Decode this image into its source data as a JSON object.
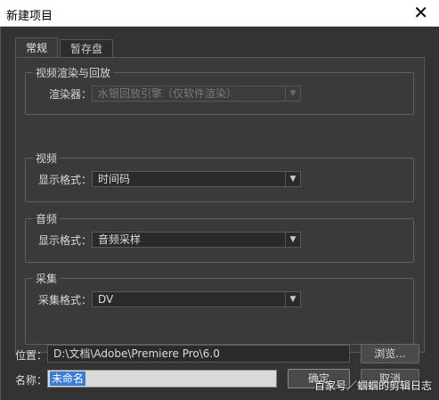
{
  "window": {
    "title": "新建项目"
  },
  "tabs": [
    {
      "label": "常规",
      "active": true
    },
    {
      "label": "暂存盘",
      "active": false
    }
  ],
  "groups": {
    "playback": {
      "title": "视频渲染与回放",
      "field_label": "渲染器：",
      "value": "水银回放引擎（仅软件渲染）",
      "disabled": true
    },
    "video": {
      "title": "视频",
      "field_label": "显示格式：",
      "value": "时间码"
    },
    "audio": {
      "title": "音频",
      "field_label": "显示格式：",
      "value": "音频采样"
    },
    "capture": {
      "title": "采集",
      "field_label": "采集格式：",
      "value": "DV"
    }
  },
  "location": {
    "label": "位置：",
    "value": "D:\\文档\\Adobe\\Premiere Pro\\6.0",
    "browse_label": "浏览..."
  },
  "name": {
    "label": "名称：",
    "value": "未命名"
  },
  "buttons": {
    "ok": "确定",
    "cancel": "取消"
  },
  "watermark": "百家号／蝈蝈的剪辑日志",
  "icons": {
    "close": "close-icon",
    "dropdown": "chevron-down-icon"
  }
}
